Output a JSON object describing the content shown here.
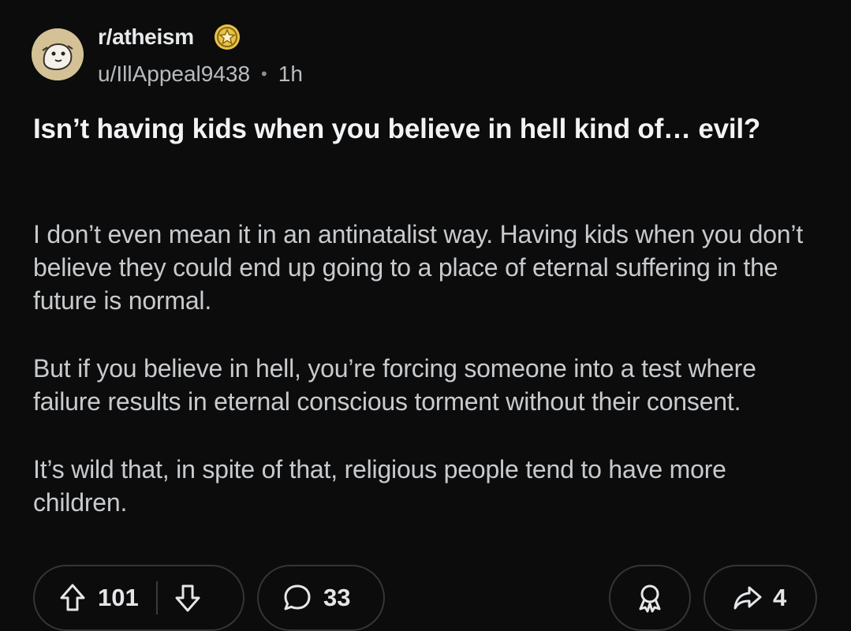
{
  "header": {
    "subreddit": "r/atheism",
    "username": "u/IllAppeal9438",
    "separator": "•",
    "time": "1h"
  },
  "post": {
    "title": "Isn’t having kids when you believe in hell kind of… evil?",
    "paragraphs": [
      "I don’t even mean it in an antinatalist way. Having kids when you don’t believe they could end up going to a place of eternal suffering in the future is normal.",
      "But if you believe in hell, you’re forcing someone into a test where failure results in eternal conscious torment without their consent.",
      "It’s wild that, in spite of that, religious people tend to have more children."
    ]
  },
  "actions": {
    "votes": "101",
    "comments": "33",
    "shares": "4"
  },
  "icons": {
    "badge": "achievement-badge-icon",
    "upvote": "upvote-arrow-icon",
    "downvote": "downvote-arrow-icon",
    "comment": "comment-bubble-icon",
    "award": "award-ribbon-icon",
    "share": "share-arrow-icon"
  },
  "colors": {
    "background": "#0c0c0d",
    "pill_border": "#343536",
    "text_primary": "#f1f3f4",
    "text_body": "#c8cbce",
    "badge_gold": "#e8c24a"
  }
}
